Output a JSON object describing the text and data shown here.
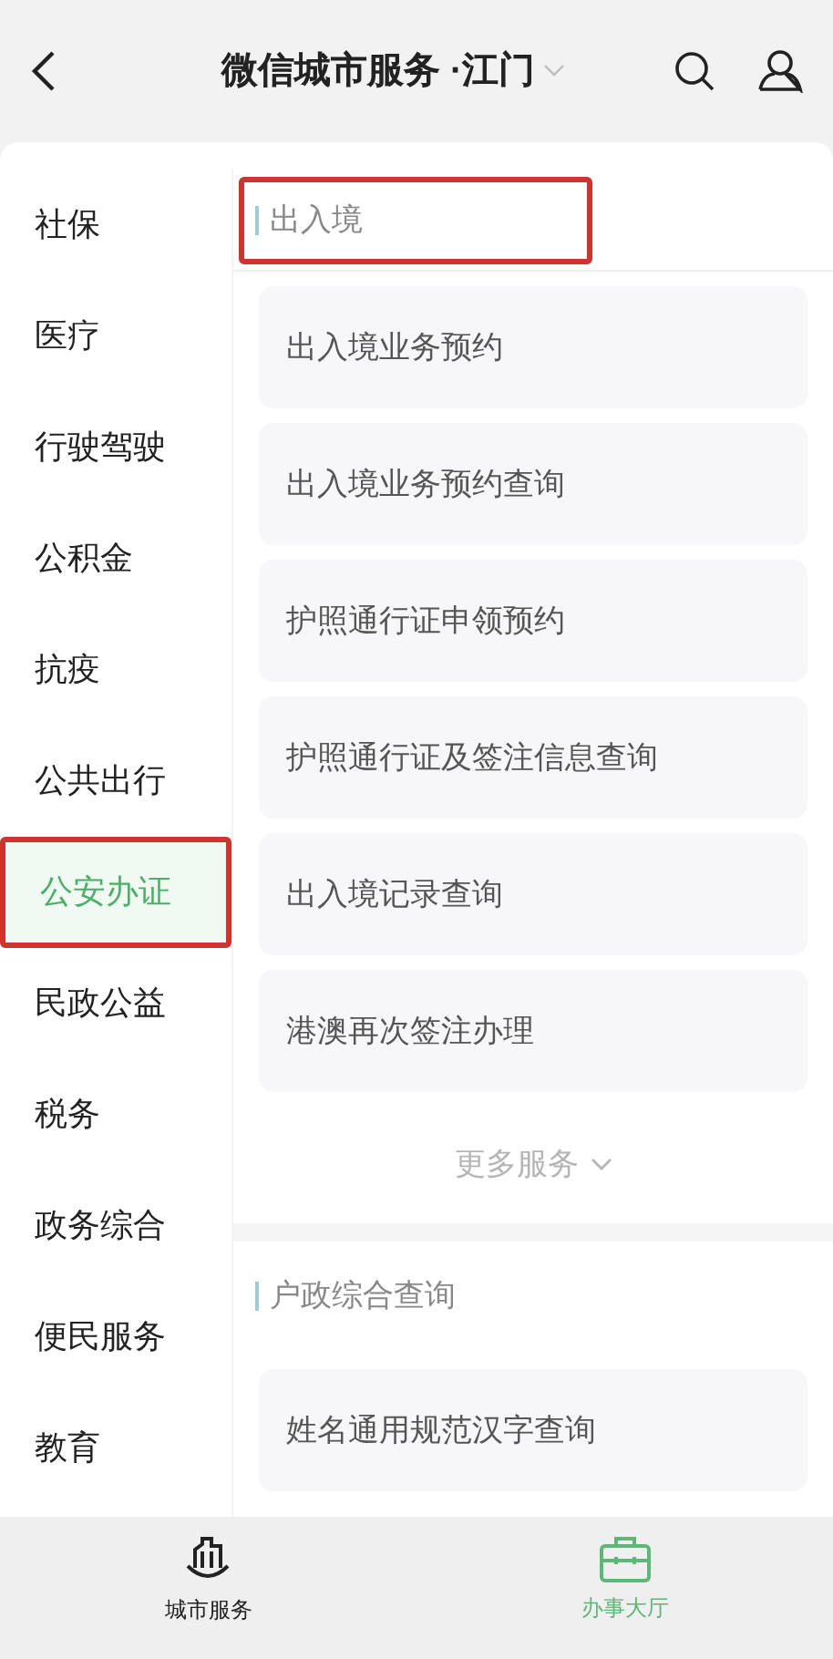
{
  "header": {
    "title": "微信城市服务 ·江门"
  },
  "sidebar": {
    "items": [
      {
        "label": "社保",
        "selected": false,
        "highlighted": false
      },
      {
        "label": "医疗",
        "selected": false,
        "highlighted": false
      },
      {
        "label": "行驶驾驶",
        "selected": false,
        "highlighted": false
      },
      {
        "label": "公积金",
        "selected": false,
        "highlighted": false
      },
      {
        "label": "抗疫",
        "selected": false,
        "highlighted": false
      },
      {
        "label": "公共出行",
        "selected": false,
        "highlighted": false
      },
      {
        "label": "公安办证",
        "selected": true,
        "highlighted": true
      },
      {
        "label": "民政公益",
        "selected": false,
        "highlighted": false
      },
      {
        "label": "税务",
        "selected": false,
        "highlighted": false
      },
      {
        "label": "政务综合",
        "selected": false,
        "highlighted": false
      },
      {
        "label": "便民服务",
        "selected": false,
        "highlighted": false
      },
      {
        "label": "教育",
        "selected": false,
        "highlighted": false
      }
    ]
  },
  "sections": [
    {
      "title": "出入境",
      "highlighted": true,
      "items": [
        "出入境业务预约",
        "出入境业务预约查询",
        "护照通行证申领预约",
        "护照通行证及签注信息查询",
        "出入境记录查询",
        "港澳再次签注办理"
      ],
      "more": "更多服务"
    },
    {
      "title": "户政综合查询",
      "highlighted": false,
      "items": [
        "姓名通用规范汉字查询"
      ]
    }
  ],
  "bottom_nav": [
    {
      "label": "城市服务",
      "kind": "city",
      "selected": false
    },
    {
      "label": "办事大厅",
      "kind": "hall",
      "selected": true
    }
  ]
}
